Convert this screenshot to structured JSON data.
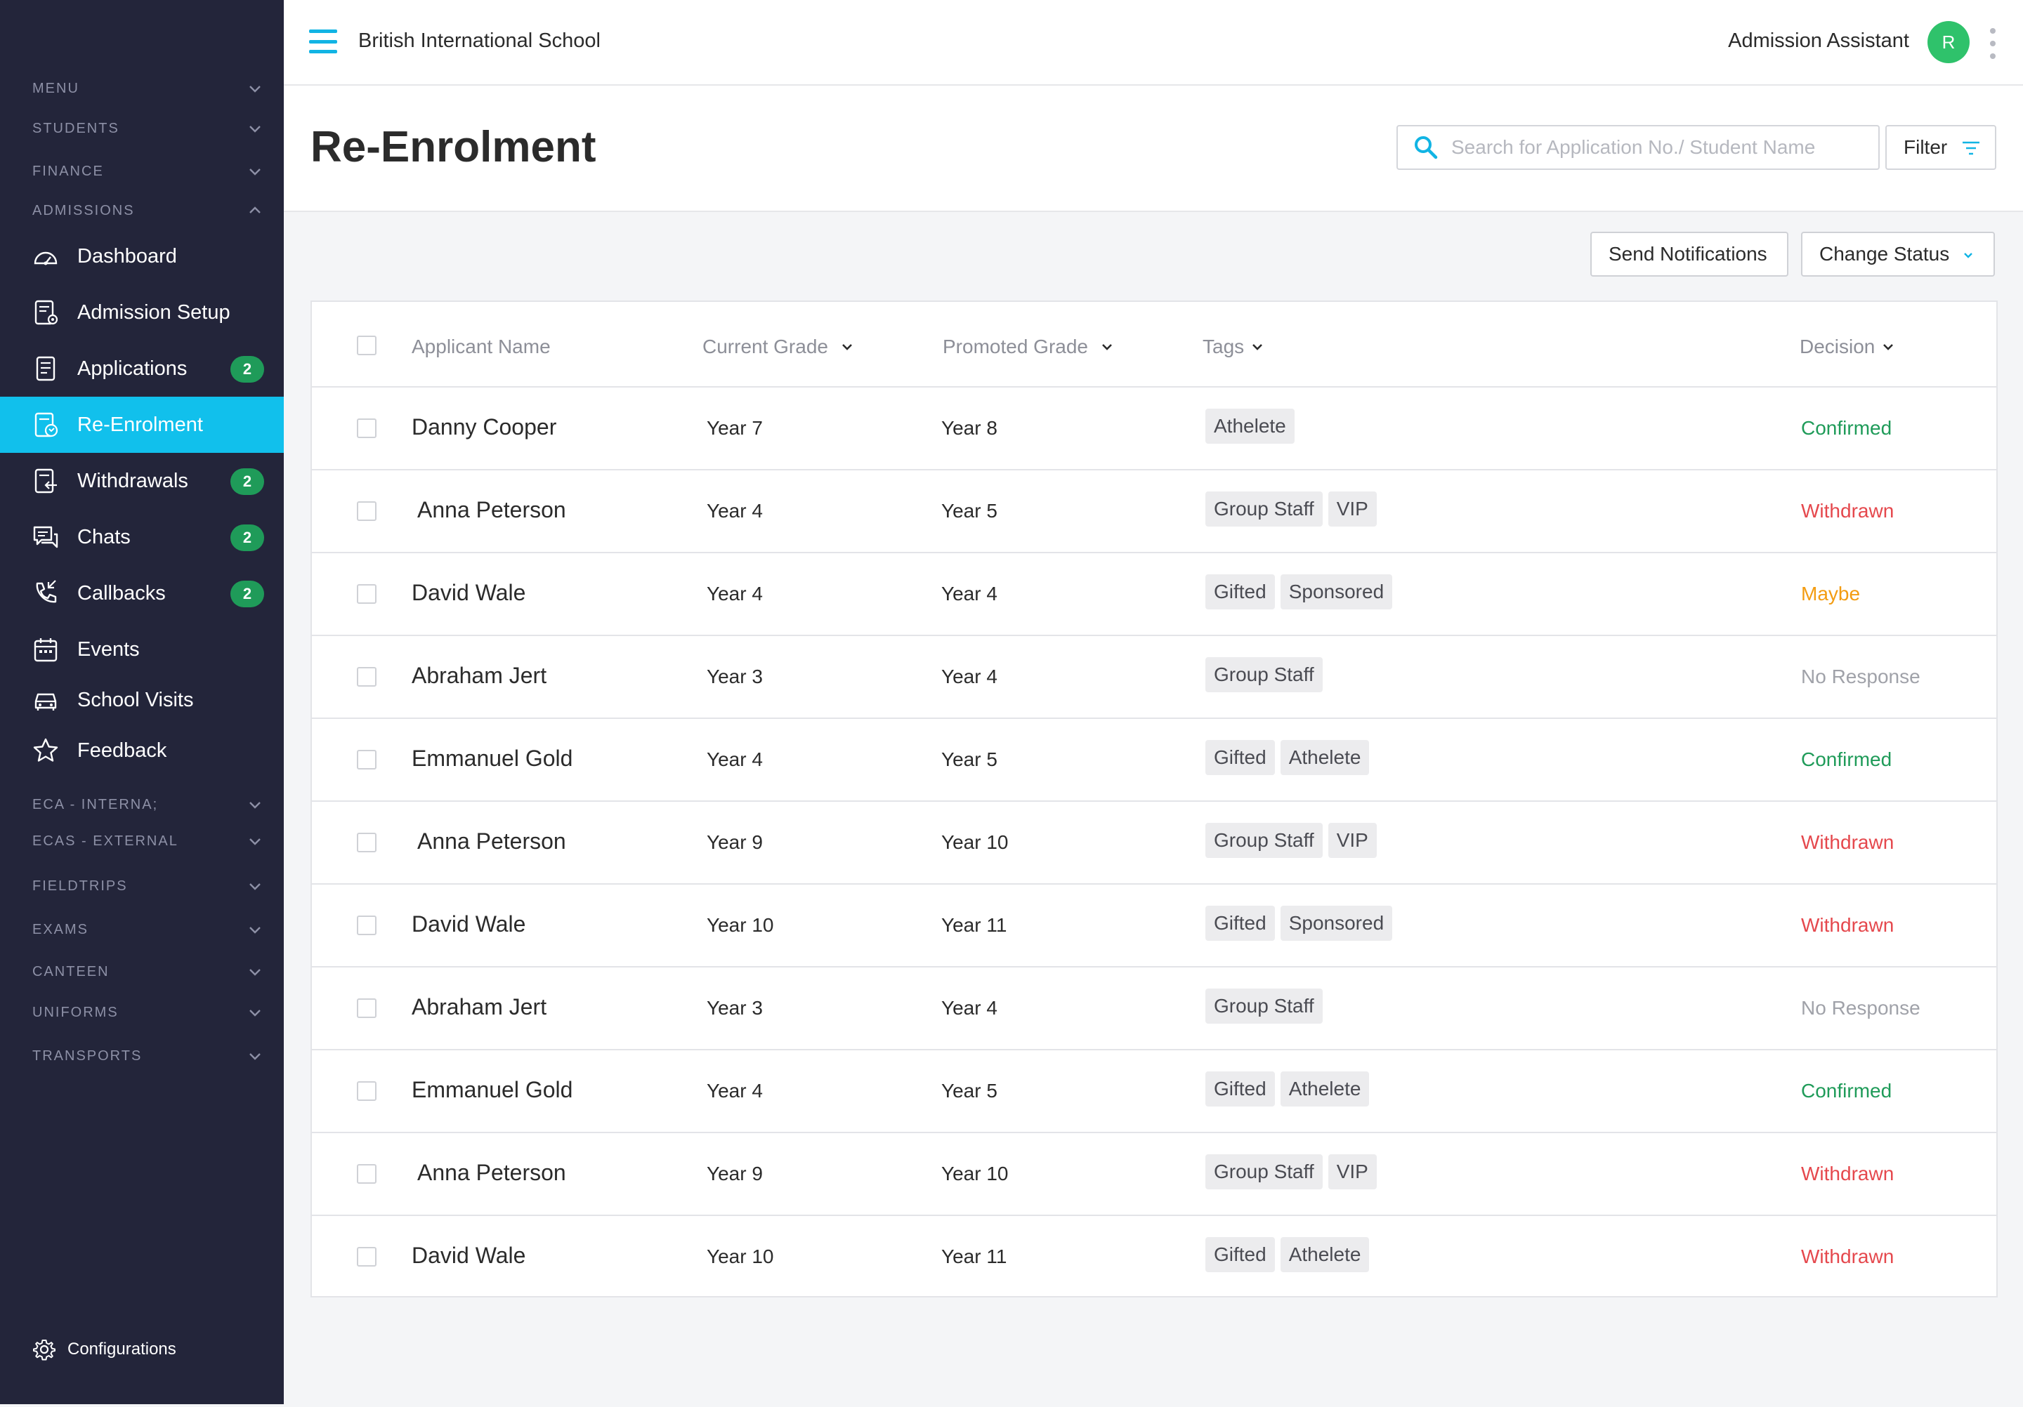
{
  "colors": {
    "sidebar_bg": "#23253a",
    "active_nav": "#11c0ec",
    "badge": "#1f9b59",
    "avatar": "#2fc26b",
    "confirmed": "#1f9b59",
    "withdrawn": "#e5484d",
    "maybe": "#f39c12",
    "no_response": "#a0a2a9"
  },
  "sidebar": {
    "sections_top": [
      {
        "label": "MENU",
        "icon": "chevron-down-icon"
      },
      {
        "label": "STUDENTS",
        "icon": "chevron-down-icon"
      },
      {
        "label": "FINANCE",
        "icon": "chevron-down-icon"
      },
      {
        "label": "ADMISSIONS",
        "icon": "chevron-up-icon"
      }
    ],
    "items": [
      {
        "label": "Dashboard",
        "icon": "dashboard-icon",
        "badge": ""
      },
      {
        "label": "Admission Setup",
        "icon": "admission-setup-icon",
        "badge": ""
      },
      {
        "label": "Applications",
        "icon": "applications-icon",
        "badge": "2"
      },
      {
        "label": "Re-Enrolment",
        "icon": "re-enrolment-icon",
        "badge": "",
        "active": true
      },
      {
        "label": "Withdrawals",
        "icon": "withdrawals-icon",
        "badge": "2"
      },
      {
        "label": "Chats",
        "icon": "chats-icon",
        "badge": "2"
      },
      {
        "label": "Callbacks",
        "icon": "callbacks-icon",
        "badge": "2"
      },
      {
        "label": "Events",
        "icon": "calendar-icon",
        "badge": ""
      },
      {
        "label": "School Visits",
        "icon": "car-icon",
        "badge": ""
      },
      {
        "label": "Feedback",
        "icon": "star-icon",
        "badge": ""
      }
    ],
    "sections_bottom": [
      {
        "label": "ECA - INTERNA;",
        "icon": "chevron-down-icon"
      },
      {
        "label": "ECAS - EXTERNAL",
        "icon": "chevron-down-icon"
      },
      {
        "label": "FIELDTRIPS",
        "icon": "chevron-down-icon"
      },
      {
        "label": "EXAMS",
        "icon": "chevron-down-icon"
      },
      {
        "label": "CANTEEN",
        "icon": "chevron-down-icon"
      },
      {
        "label": "UNIFORMS",
        "icon": "chevron-down-icon"
      },
      {
        "label": "TRANSPORTS",
        "icon": "chevron-down-icon"
      }
    ],
    "config_label": "Configurations"
  },
  "topbar": {
    "school_name": "British International School",
    "role": "Admission Assistant",
    "avatar_initial": "R"
  },
  "header": {
    "title": "Re-Enrolment",
    "search_placeholder": "Search for Application No./ Student Name",
    "filter_label": "Filter"
  },
  "actions": {
    "send_notifications": "Send Notifications",
    "change_status": "Change Status"
  },
  "table": {
    "columns": {
      "applicant": "Applicant Name",
      "current": "Current Grade",
      "promoted": "Promoted Grade",
      "tags": "Tags",
      "decision": "Decision"
    },
    "rows": [
      {
        "name": "Danny Cooper",
        "current": "Year 7",
        "promoted": "Year 8",
        "tags": [
          "Athelete"
        ],
        "decision": "Confirmed",
        "status": "confirmed"
      },
      {
        "name": "Anna Peterson",
        "current": "Year 4",
        "promoted": "Year 5",
        "tags": [
          "Group Staff",
          "VIP"
        ],
        "decision": "Withdrawn",
        "status": "withdrawn"
      },
      {
        "name": "David Wale",
        "current": "Year 4",
        "promoted": "Year 4",
        "tags": [
          "Gifted",
          "Sponsored"
        ],
        "decision": "Maybe",
        "status": "maybe"
      },
      {
        "name": "Abraham Jert",
        "current": "Year 3",
        "promoted": "Year 4",
        "tags": [
          "Group Staff"
        ],
        "decision": "No Response",
        "status": "no_response"
      },
      {
        "name": "Emmanuel Gold",
        "current": "Year 4",
        "promoted": "Year 5",
        "tags": [
          "Gifted",
          "Athelete"
        ],
        "decision": "Confirmed",
        "status": "confirmed"
      },
      {
        "name": "Anna Peterson",
        "current": "Year 9",
        "promoted": "Year 10",
        "tags": [
          "Group Staff",
          "VIP"
        ],
        "decision": "Withdrawn",
        "status": "withdrawn"
      },
      {
        "name": "David Wale",
        "current": "Year 10",
        "promoted": "Year 11",
        "tags": [
          "Gifted",
          "Sponsored"
        ],
        "decision": "Withdrawn",
        "status": "withdrawn"
      },
      {
        "name": "Abraham Jert",
        "current": "Year 3",
        "promoted": "Year 4",
        "tags": [
          "Group Staff"
        ],
        "decision": "No Response",
        "status": "no_response"
      },
      {
        "name": "Emmanuel Gold",
        "current": "Year 4",
        "promoted": "Year 5",
        "tags": [
          "Gifted",
          "Athelete"
        ],
        "decision": "Confirmed",
        "status": "confirmed"
      },
      {
        "name": "Anna Peterson",
        "current": "Year 9",
        "promoted": "Year 10",
        "tags": [
          "Group Staff",
          "VIP"
        ],
        "decision": "Withdrawn",
        "status": "withdrawn"
      },
      {
        "name": "David Wale",
        "current": "Year 10",
        "promoted": "Year 11",
        "tags": [
          "Gifted",
          "Athelete"
        ],
        "decision": "Withdrawn",
        "status": "withdrawn"
      }
    ]
  }
}
